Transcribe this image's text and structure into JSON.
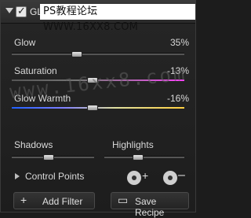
{
  "header": {
    "title": "GL",
    "watermark": "PS教程论坛 WWW.16XX8.COM"
  },
  "sliders": [
    {
      "label": "Glow",
      "value": "35%"
    },
    {
      "label": "Saturation",
      "value": "-13%"
    },
    {
      "label": "Glow Warmth",
      "value": "-16%"
    }
  ],
  "bottom_sliders": [
    {
      "label": "Shadows"
    },
    {
      "label": "Highlights"
    }
  ],
  "watermark_vertical": "www.16xx8.com",
  "control_points": {
    "label": "Control Points"
  },
  "buttons": {
    "add_filter": "Add Filter",
    "save_recipe": "Save Recipe"
  },
  "icons": {
    "add": "plus-icon",
    "save": "save-icon"
  }
}
